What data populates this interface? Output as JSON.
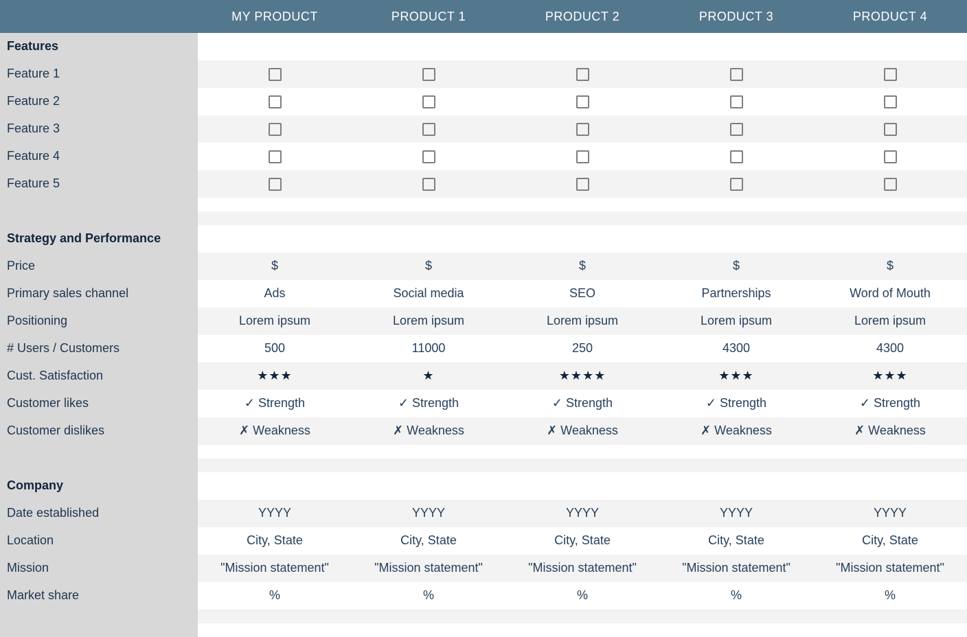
{
  "columns": [
    "MY PRODUCT",
    "PRODUCT 1",
    "PRODUCT 2",
    "PRODUCT 3",
    "PRODUCT 4"
  ],
  "sections": [
    {
      "title": "Features",
      "rows": [
        {
          "label": "Feature 1",
          "type": "checkbox",
          "values": [
            false,
            false,
            false,
            false,
            false
          ]
        },
        {
          "label": "Feature 2",
          "type": "checkbox",
          "values": [
            false,
            false,
            false,
            false,
            false
          ]
        },
        {
          "label": "Feature 3",
          "type": "checkbox",
          "values": [
            false,
            false,
            false,
            false,
            false
          ]
        },
        {
          "label": "Feature 4",
          "type": "checkbox",
          "values": [
            false,
            false,
            false,
            false,
            false
          ]
        },
        {
          "label": "Feature 5",
          "type": "checkbox",
          "values": [
            false,
            false,
            false,
            false,
            false
          ]
        }
      ]
    },
    {
      "title": "Strategy and Performance",
      "rows": [
        {
          "label": "Price",
          "type": "text",
          "values": [
            "$",
            "$",
            "$",
            "$",
            "$"
          ]
        },
        {
          "label": "Primary sales channel",
          "type": "text",
          "values": [
            "Ads",
            "Social media",
            "SEO",
            "Partnerships",
            "Word of Mouth"
          ]
        },
        {
          "label": "Positioning",
          "type": "text",
          "values": [
            "Lorem ipsum",
            "Lorem ipsum",
            "Lorem ipsum",
            "Lorem ipsum",
            "Lorem ipsum"
          ]
        },
        {
          "label": "# Users / Customers",
          "type": "text",
          "values": [
            "500",
            "11000",
            "250",
            "4300",
            "4300"
          ]
        },
        {
          "label": "Cust. Satisfaction",
          "type": "stars",
          "values": [
            3,
            1,
            4,
            3,
            3
          ]
        },
        {
          "label": "Customer likes",
          "type": "text",
          "values": [
            "✓ Strength",
            "✓ Strength",
            "✓ Strength",
            "✓ Strength",
            "✓ Strength"
          ]
        },
        {
          "label": "Customer dislikes",
          "type": "text",
          "values": [
            "✗ Weakness",
            "✗ Weakness",
            "✗ Weakness",
            "✗ Weakness",
            "✗ Weakness"
          ]
        }
      ]
    },
    {
      "title": "Company",
      "rows": [
        {
          "label": "Date established",
          "type": "text",
          "values": [
            "YYYY",
            "YYYY",
            "YYYY",
            "YYYY",
            "YYYY"
          ]
        },
        {
          "label": "Location",
          "type": "text",
          "values": [
            "City, State",
            "City, State",
            "City, State",
            "City, State",
            "City, State"
          ]
        },
        {
          "label": "Mission",
          "type": "text",
          "values": [
            "\"Mission statement\"",
            "\"Mission statement\"",
            "\"Mission statement\"",
            "\"Mission statement\"",
            "\"Mission statement\""
          ]
        },
        {
          "label": "Market share",
          "type": "text",
          "values": [
            "%",
            "%",
            "%",
            "%",
            "%"
          ]
        }
      ]
    }
  ]
}
